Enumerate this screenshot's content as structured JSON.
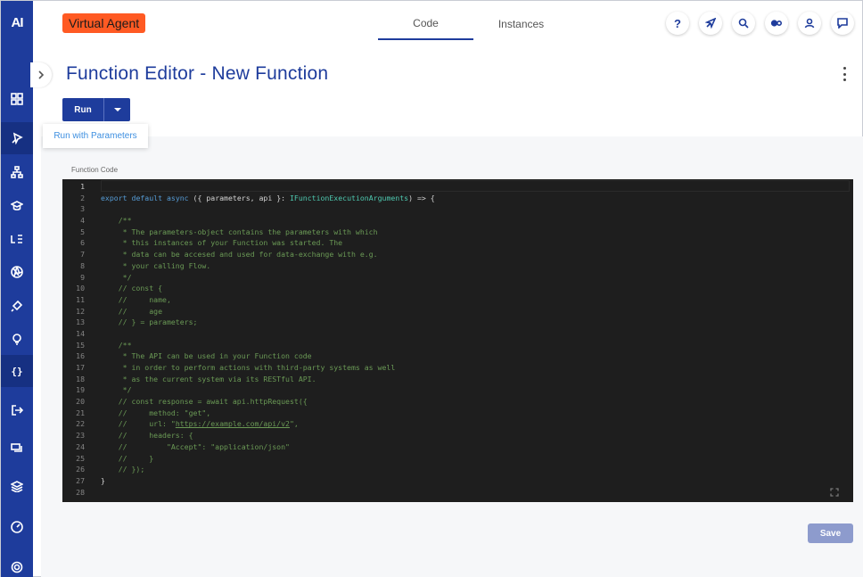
{
  "app": {
    "logo": "AI",
    "brand_badge": "Virtual Agent"
  },
  "tabs": [
    {
      "label": "Code"
    },
    {
      "label": "Instances"
    }
  ],
  "header_icons": {
    "help": "?"
  },
  "page": {
    "title": "Function Editor - New Function"
  },
  "toolbar": {
    "run_label": "Run",
    "dropdown_item": "Run with Parameters"
  },
  "editor": {
    "label": "Function Code",
    "lines": [
      "",
      "export default async ({ parameters, api }: IFunctionExecutionArguments) => {",
      "",
      "    /**",
      "     * The parameters-object contains the parameters with which",
      "     * this instances of your Function was started. The",
      "     * data can be accesed and used for data-exchange with e.g.",
      "     * your calling Flow.",
      "     */",
      "    // const {",
      "    //     name,",
      "    //     age",
      "    // } = parameters;",
      "",
      "    /**",
      "     * The API can be used in your Function code",
      "     * in order to perform actions with third-party systems as well",
      "     * as the current system via its RESTful API.",
      "     */",
      "    // const response = await api.httpRequest({",
      "    //     method: \"get\",",
      "    //     url: \"https://example.com/api/v2\",",
      "    //     headers: {",
      "    //         \"Accept\": \"application/json\"",
      "    //     }",
      "    // });",
      "}",
      ""
    ],
    "line_numbers": [
      "1",
      "2",
      "3",
      "4",
      "5",
      "6",
      "7",
      "8",
      "9",
      "10",
      "11",
      "12",
      "13",
      "14",
      "15",
      "16",
      "17",
      "18",
      "19",
      "20",
      "21",
      "22",
      "23",
      "24",
      "25",
      "26",
      "27",
      "28"
    ]
  },
  "footer": {
    "save_label": "Save"
  },
  "colors": {
    "primary": "#1e3c9c",
    "brand": "#ff5a23",
    "editor_bg": "#1e1e1e",
    "save_disabled": "#8d9bcd"
  }
}
